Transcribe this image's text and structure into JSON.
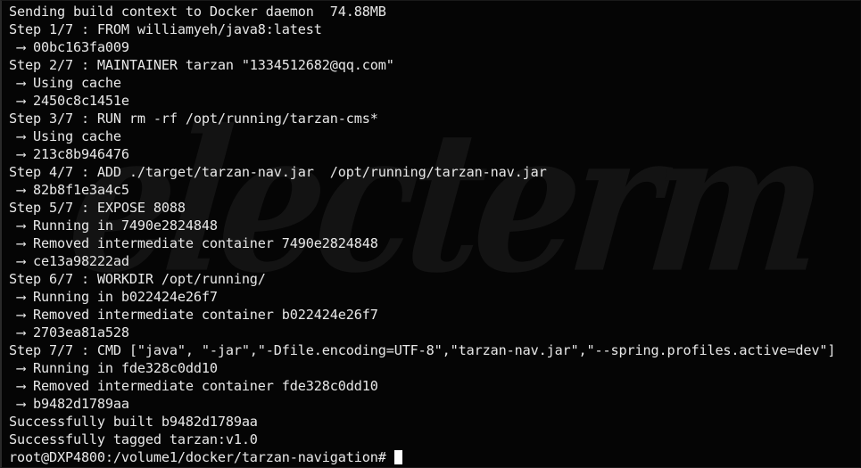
{
  "window": {
    "app": "electerm",
    "watermark_text": "electerm",
    "background_color": "#050505",
    "foreground_color": "#e8e8e8",
    "cursor_color": "#ffffff",
    "watermark_color": "#131313",
    "border_color": "#2a2a2a"
  },
  "terminal": {
    "arrow_glyph": "⟶",
    "lines": [
      "Sending build context to Docker daemon  74.88MB",
      "Step 1/7 : FROM williamyeh/java8:latest",
      " ⟶ 00bc163fa009",
      "Step 2/7 : MAINTAINER tarzan \"1334512682@qq.com\"",
      " ⟶ Using cache",
      " ⟶ 2450c8c1451e",
      "Step 3/7 : RUN rm -rf /opt/running/tarzan-cms*",
      " ⟶ Using cache",
      " ⟶ 213c8b946476",
      "Step 4/7 : ADD ./target/tarzan-nav.jar  /opt/running/tarzan-nav.jar",
      " ⟶ 82b8f1e3a4c5",
      "Step 5/7 : EXPOSE 8088",
      " ⟶ Running in 7490e2824848",
      " ⟶ Removed intermediate container 7490e2824848",
      " ⟶ ce13a98222ad",
      "Step 6/7 : WORKDIR /opt/running/",
      " ⟶ Running in b022424e26f7",
      " ⟶ Removed intermediate container b022424e26f7",
      " ⟶ 2703ea81a528",
      "Step 7/7 : CMD [\"java\", \"-jar\",\"-Dfile.encoding=UTF-8\",\"tarzan-nav.jar\",\"--spring.profiles.active=dev\"]",
      " ⟶ Running in fde328c0dd10",
      " ⟶ Removed intermediate container fde328c0dd10",
      " ⟶ b9482d1789aa",
      "Successfully built b9482d1789aa",
      "Successfully tagged tarzan:v1.0"
    ],
    "prompt": {
      "user": "root",
      "at": "@",
      "host": "DXP4800",
      "separator": ":",
      "path": "/volume1/docker/tarzan-navigation",
      "symbol": "#",
      "full": "root@DXP4800:/volume1/docker/tarzan-navigation# "
    },
    "build": {
      "context_size": "74.88MB",
      "total_steps": 7,
      "image_id": "b9482d1789aa",
      "image_tag": "tarzan:v1.0",
      "base_image": "williamyeh/java8:latest",
      "maintainer": "tarzan",
      "maintainer_email": "1334512682@qq.com",
      "exposed_port": "8088",
      "workdir": "/opt/running/"
    }
  }
}
